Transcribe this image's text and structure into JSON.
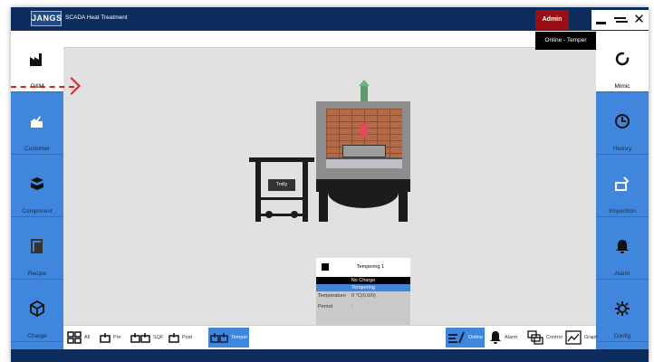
{
  "header": {
    "logo": "JANGS",
    "title": "SCADA Heat Treatment",
    "user": "Admin",
    "mode": "Online - Temper",
    "window_close": "✕"
  },
  "left_nav": [
    {
      "label": "O&M",
      "icon": "factory-icon",
      "active": true
    },
    {
      "label": "Customer",
      "icon": "customer-icon"
    },
    {
      "label": "Component",
      "icon": "component-icon"
    },
    {
      "label": "Recipe",
      "icon": "recipe-icon"
    },
    {
      "label": "Charge",
      "icon": "charge-icon"
    }
  ],
  "right_nav": [
    {
      "label": "Mimic",
      "icon": "refresh-icon",
      "active": true
    },
    {
      "label": "History",
      "icon": "clock-icon"
    },
    {
      "label": "Inspection",
      "icon": "inspection-icon"
    },
    {
      "label": "Alarm",
      "icon": "bell-icon"
    },
    {
      "label": "Config",
      "icon": "gear-icon"
    }
  ],
  "bottom_tabs": [
    {
      "label": "All",
      "icon": "grid-icon"
    },
    {
      "label": "Pre",
      "icon": "pre-furnace-icon"
    },
    {
      "label": "SQF",
      "icon": "sqf-furnace-icon"
    },
    {
      "label": "Post",
      "icon": "post-furnace-icon"
    },
    {
      "label": "Temper",
      "icon": "temper-furnace-icon",
      "active": true
    }
  ],
  "bottom_actions": [
    {
      "label": "Online",
      "icon": "online-icon",
      "active": true
    },
    {
      "label": "Alarm",
      "icon": "bell-icon"
    },
    {
      "label": "Control",
      "icon": "control-icon"
    },
    {
      "label": "Graph",
      "icon": "graph-icon"
    }
  ],
  "mimic": {
    "trolley_label": "Trolly"
  },
  "furnace_panel": {
    "title": "Tempering 1",
    "charge_state": "No Charge",
    "stage": "Tempering",
    "temperature_label": "Temperature",
    "temperature_value": "0 °C(0.0/0)",
    "period_label": "Period",
    "period_value": ":"
  },
  "colors": {
    "nav_blue": "#3f86dc",
    "title_navy": "#0b2c5c",
    "admin_red": "#9a0f16",
    "annotation_arrow": "#e0221f"
  }
}
